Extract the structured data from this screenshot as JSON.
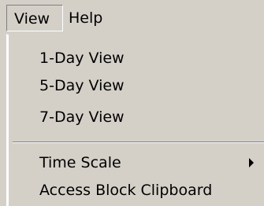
{
  "menubar": {
    "items": [
      {
        "label": "View"
      },
      {
        "label": "Help"
      }
    ]
  },
  "view_menu": {
    "items": [
      {
        "label": "1-Day View"
      },
      {
        "label": "5-Day View"
      },
      {
        "label": "7-Day View"
      },
      {
        "label": "Time Scale",
        "submenu_icon": "submenu-arrow-icon"
      },
      {
        "label": "Access Block Clipboard"
      }
    ]
  }
}
